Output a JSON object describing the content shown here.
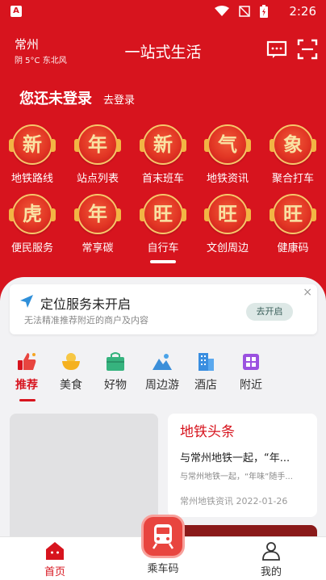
{
  "status_bar": {
    "time": "2:26",
    "app_badge": "A"
  },
  "header": {
    "city": "常州",
    "weather": "阴 5°C 东北风",
    "title": "一站式生活"
  },
  "login": {
    "title": "您还未登录",
    "link": "去登录"
  },
  "services": [
    [
      {
        "glyph": "新",
        "label": "地铁路线"
      },
      {
        "glyph": "年",
        "label": "站点列表"
      },
      {
        "glyph": "新",
        "label": "首末班车"
      },
      {
        "glyph": "气",
        "label": "地铁资讯"
      },
      {
        "glyph": "象",
        "label": "聚合打车"
      }
    ],
    [
      {
        "glyph": "虎",
        "label": "便民服务"
      },
      {
        "glyph": "年",
        "label": "常享碳"
      },
      {
        "glyph": "旺",
        "label": "自行车"
      },
      {
        "glyph": "旺",
        "label": "文创周边"
      },
      {
        "glyph": "旺",
        "label": "健康码"
      }
    ]
  ],
  "location_card": {
    "title": "定位服务未开启",
    "desc": "无法精准推荐附近的商户及内容",
    "button": "去开启",
    "close": "×"
  },
  "categories": [
    {
      "label": "推荐",
      "icon": "thumbs-up-icon",
      "active": true
    },
    {
      "label": "美食",
      "icon": "food-bowl-icon"
    },
    {
      "label": "好物",
      "icon": "shopping-bag-icon"
    },
    {
      "label": "周边游",
      "icon": "mountain-icon"
    },
    {
      "label": "酒店",
      "icon": "hotel-icon"
    },
    {
      "label": "附近",
      "icon": "nearby-grid-icon"
    }
  ],
  "news": {
    "section_title": "地铁头条",
    "headline": "与常州地铁一起，“年...",
    "summary": "与常州地铁一起，“年味”随手...",
    "source": "常州地铁资讯",
    "date": "2022-01-26"
  },
  "bottom_nav": [
    {
      "label": "首页",
      "icon": "home-icon",
      "active": true
    },
    {
      "label": "乘车码",
      "icon": "train-icon"
    },
    {
      "label": "我的",
      "icon": "user-icon"
    }
  ],
  "colors": {
    "brand_red": "#d7141e",
    "gold": "#f7c66a"
  }
}
